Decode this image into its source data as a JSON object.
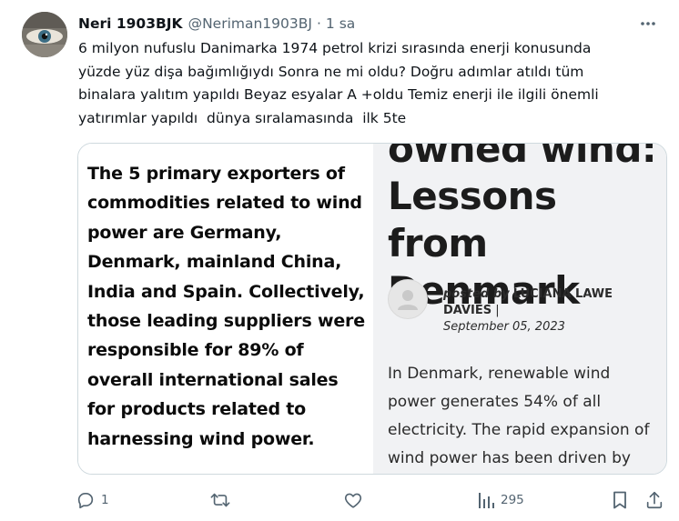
{
  "tweet": {
    "author_name": "Neri 1903BJK",
    "handle": "@Neriman1903BJ",
    "separator": "·",
    "time": "1 sa",
    "more_label": "•••",
    "text": "6 milyon nufuslu Danimarka 1974 petrol krizi sırasında enerji konusunda\nyüzde yüz dişa bağımlığıydı Sonra ne mi oldu? Doğru adımlar atıldı tüm\nbinalara yalıtım yapıldı Beyaz esyalar A +oldu Temiz enerji ile ilgili önemli\nyatırımlar yapıldı  dünya sıralamasında  ilk 5te"
  },
  "media": {
    "left_text": "The 5 primary exporters of commodities related to wind power are Germany, Denmark, mainland China, India and Spain. Collectively, those leading suppliers were responsible for 89% of overall international sales for products related to harnessing wind power.",
    "article_title": "owned wind:\nLessons from\nDenmark",
    "posted_by": "posted by",
    "author": "LUCIANA LAWE DAVIES",
    "author_sep": "|",
    "date": "September 05, 2023",
    "body": "In Denmark, renewable wind power generates 54% of all electricity. The rapid expansion of wind power has been driven by"
  },
  "actions": {
    "reply_count": "1",
    "retweet_count": "",
    "like_count": "",
    "views_count": "295"
  },
  "icons": [
    "reply-icon",
    "retweet-icon",
    "like-icon",
    "views-icon",
    "bookmark-icon",
    "share-icon",
    "more-icon"
  ],
  "colors": {
    "text": "#0f1419",
    "secondary": "#536471",
    "border": "#cfd9de",
    "media_right_bg": "#f1f2f4"
  }
}
